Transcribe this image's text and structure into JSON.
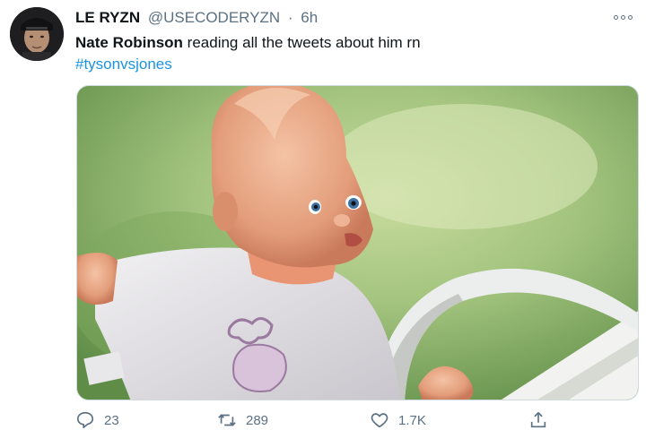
{
  "tweet": {
    "author_name": "LE RYZN",
    "author_handle": "@USECODERYZN",
    "separator": "·",
    "time": "6h",
    "text_mention": "Nate Robinson",
    "text_body": " reading all the tweets about him rn",
    "hashtag": "#tysonvsjones"
  },
  "actions": {
    "reply_count": "23",
    "retweet_count": "289",
    "like_count": "1.7K"
  },
  "icons": {
    "more": "more-options-icon",
    "reply": "reply-icon",
    "retweet": "retweet-icon",
    "like": "heart-icon",
    "share": "share-icon"
  },
  "colors": {
    "link": "#1b95e0",
    "secondary_text": "#5b7083"
  }
}
